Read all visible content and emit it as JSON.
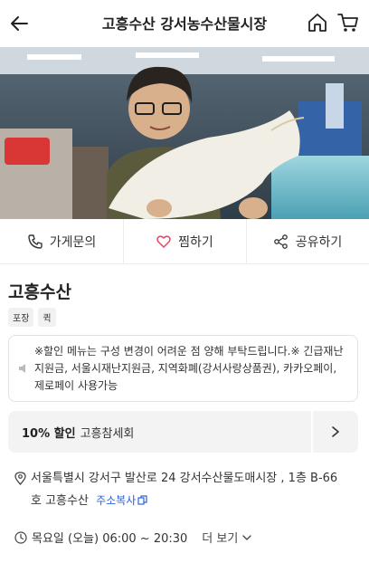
{
  "header": {
    "title": "고흥수산 강서농수산물시장",
    "icons": [
      "back-arrow-icon",
      "home-icon",
      "cart-icon"
    ]
  },
  "actions": [
    {
      "label": "가게문의",
      "icon": "phone-icon"
    },
    {
      "label": "찜하기",
      "icon": "heart-icon",
      "color": "#e64462"
    },
    {
      "label": "공유하기",
      "icon": "share-icon"
    }
  ],
  "store": {
    "name": "고흥수산",
    "tags": [
      "포장",
      "퀵"
    ]
  },
  "notice": {
    "text": "※할인 메뉴는 구성 변경이 어려운 점 양해 부탁드립니다.※ 긴급재난지원금, 서울시재난지원금, 지역화폐(강서사랑상품권), 카카오페이, 제로페이 사용가능"
  },
  "coupon": {
    "discount": "10% 할인",
    "item": "고흥참세회"
  },
  "address": {
    "text": "서울특별시 강서구 발산로 24 강서수산물도매시장 , 1층 B-66호 고흥수산",
    "copy_label": "주소복사"
  },
  "hours": {
    "text": "목요일 (오늘) 06:00 ~ 20:30",
    "more_label": "더 보기"
  },
  "colors": {
    "accent_blue": "#2b63d9",
    "heart": "#e64462"
  }
}
